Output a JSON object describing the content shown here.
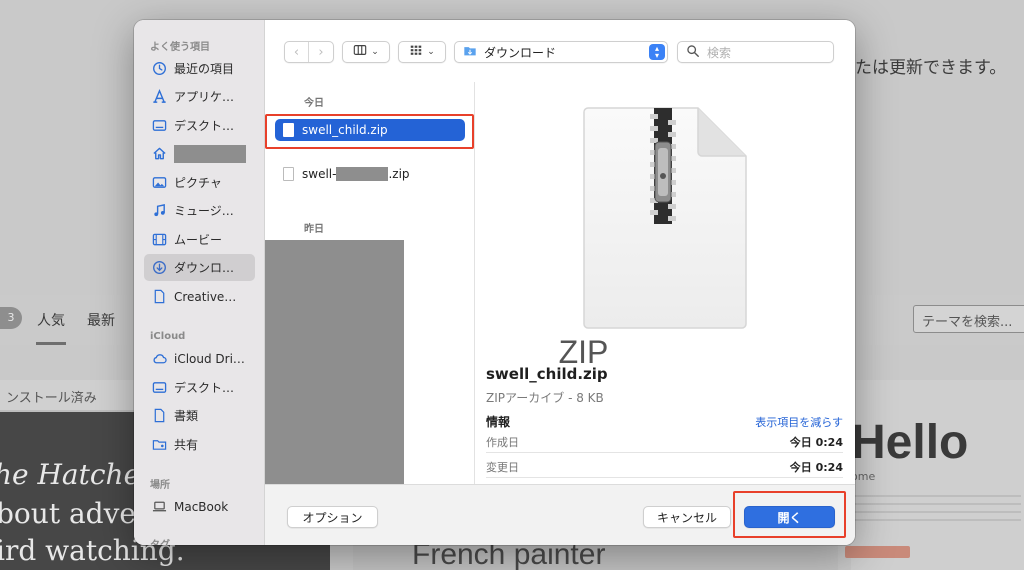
{
  "background": {
    "update_text": "たは更新できます。",
    "theme_count": "3",
    "tabs": [
      "人気",
      "最新"
    ],
    "search_placeholder": "テーマを検索...",
    "installed_label": "ンストール済み",
    "hatchery_lines": [
      "he Hatcher",
      "bout adve",
      "ird watching."
    ],
    "french_text": "French painter",
    "hello_text": "Hello",
    "ome_text": "ome"
  },
  "sidebar": {
    "favorites_heading": "よく使う項目",
    "favorites": [
      {
        "label": "最近の項目",
        "icon": "clock-icon"
      },
      {
        "label": "アプリケ…",
        "icon": "apps-icon"
      },
      {
        "label": "デスクト…",
        "icon": "desktop-icon"
      },
      {
        "label": "",
        "icon": "home-icon",
        "redacted": true
      },
      {
        "label": "ピクチャ",
        "icon": "picture-icon"
      },
      {
        "label": "ミュージ…",
        "icon": "music-icon"
      },
      {
        "label": "ムービー",
        "icon": "film-icon"
      },
      {
        "label": "ダウンロ…",
        "icon": "download-icon",
        "selected": true
      },
      {
        "label": "Creative…",
        "icon": "document-icon"
      }
    ],
    "icloud_heading": "iCloud",
    "icloud": [
      {
        "label": "iCloud Dri…",
        "icon": "cloud-icon"
      },
      {
        "label": "デスクト…",
        "icon": "desktop-icon"
      },
      {
        "label": "書類",
        "icon": "document-icon"
      },
      {
        "label": "共有",
        "icon": "shared-folder-icon"
      }
    ],
    "locations_heading": "場所",
    "locations": [
      {
        "label": "MacBook",
        "icon": "laptop-icon"
      }
    ],
    "tags_heading": "タグ"
  },
  "toolbar": {
    "back": "‹",
    "forward": "›",
    "location": "ダウンロード",
    "search_placeholder": "検索"
  },
  "file_list": {
    "today_label": "今日",
    "yesterday_label": "昨日",
    "files": [
      {
        "name": "swell_child.zip",
        "selected": true
      },
      {
        "name_prefix": "swell-",
        "name_suffix": ".zip",
        "redacted": true
      }
    ]
  },
  "preview": {
    "icon_label": "ZIP",
    "file_name": "swell_child.zip",
    "kind": "ZIPアーカイブ - 8 KB",
    "info_heading": "情報",
    "show_less": "表示項目を減らす",
    "rows": [
      {
        "key": "作成日",
        "value": "今日 0:24"
      },
      {
        "key": "変更日",
        "value": "今日 0:24"
      }
    ]
  },
  "footer": {
    "options": "オプション",
    "cancel": "キャンセル",
    "open": "開く"
  },
  "colors": {
    "accent": "#2463d6",
    "highlight_box": "#e8402a",
    "sidebar_bg": "#e8e6e8"
  }
}
